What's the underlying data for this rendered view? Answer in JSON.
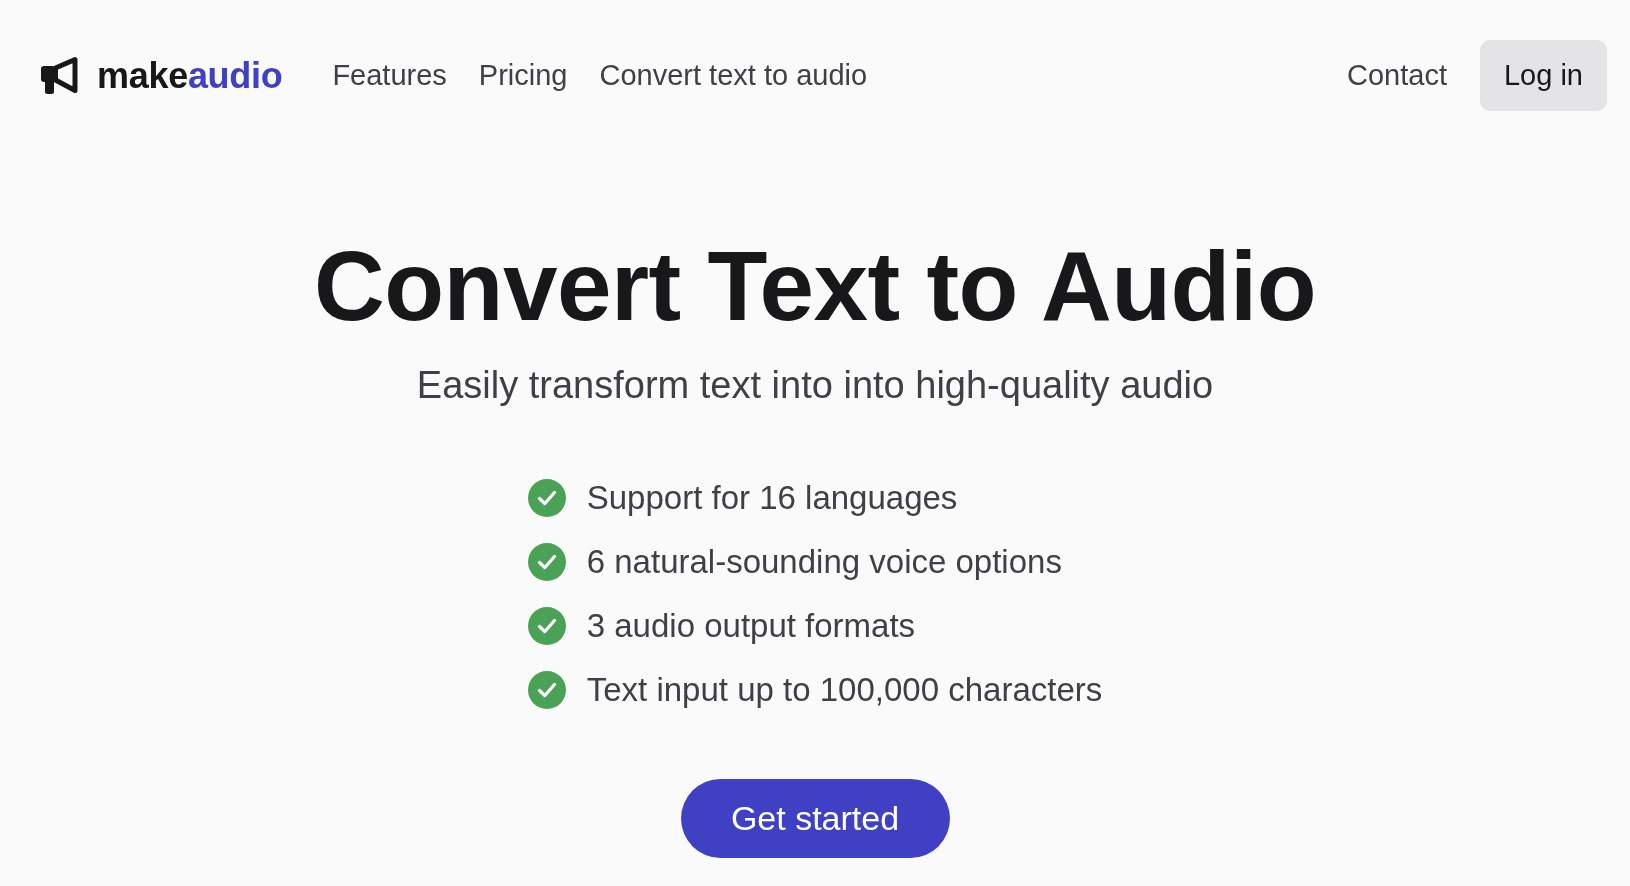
{
  "header": {
    "logo": {
      "parts": [
        {
          "text": "make",
          "accent": false
        },
        {
          "text": "audio",
          "accent": true
        }
      ]
    },
    "nav": [
      "Features",
      "Pricing",
      "Convert text to audio"
    ],
    "contact": "Contact",
    "login_button": "Log in"
  },
  "hero": {
    "title": "Convert Text to Audio",
    "subtitle": "Easily transform text into into high-quality audio",
    "features": [
      "Support for 16 languages",
      "6 natural-sounding voice options",
      "3 audio output formats",
      "Text input up to 100,000 characters"
    ],
    "cta_button": "Get started"
  }
}
